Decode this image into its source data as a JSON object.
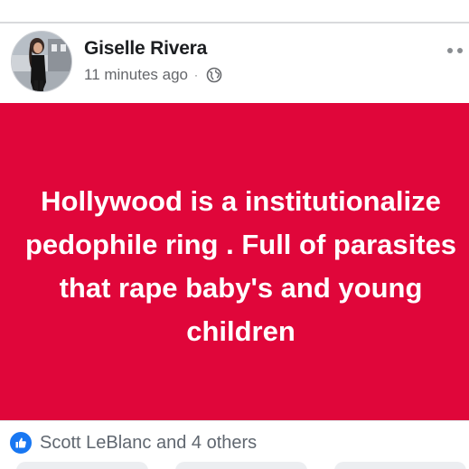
{
  "post": {
    "author": "Giselle Rivera",
    "timestamp": "11 minutes ago",
    "separator": "·",
    "privacy_icon": "globe-icon",
    "more_icon": "more-options-icon",
    "background_color": "#e0063a",
    "text": "Hollywood is a institutionalize pedophile ring . Full of parasites that rape baby's and young children"
  },
  "reactions": {
    "icon": "like-icon",
    "accent_color": "#1877f2",
    "summary": "Scott LeBlanc and 4 others"
  }
}
